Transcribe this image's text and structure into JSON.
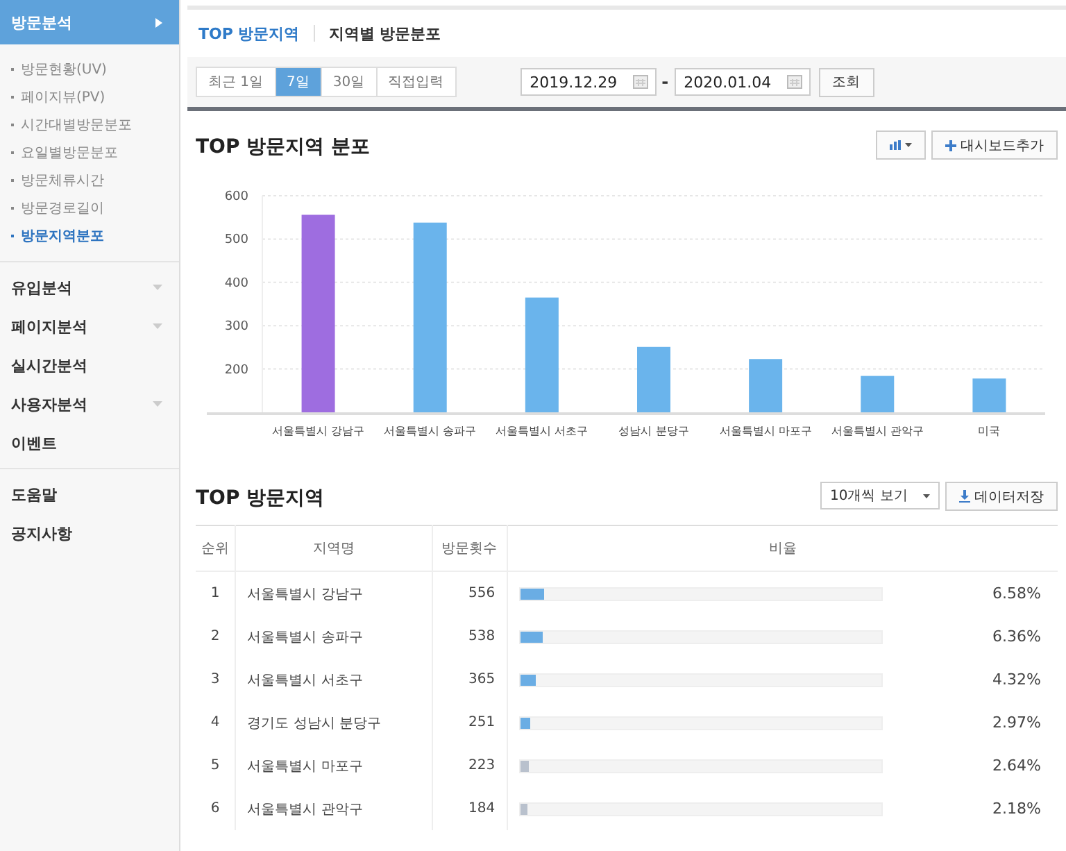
{
  "sidebar": {
    "items": [
      {
        "label": "방문분석",
        "expanded": true,
        "selected": true,
        "children": [
          {
            "label": "방문현황(UV)",
            "selected": false
          },
          {
            "label": "페이지뷰(PV)",
            "selected": false
          },
          {
            "label": "시간대별방문분포",
            "selected": false
          },
          {
            "label": "요일별방문분포",
            "selected": false
          },
          {
            "label": "방문체류시간",
            "selected": false
          },
          {
            "label": "방문경로길이",
            "selected": false
          },
          {
            "label": "방문지역분포",
            "selected": true
          }
        ]
      },
      {
        "label": "유입분석",
        "expanded": false,
        "selected": false
      },
      {
        "label": "페이지분석",
        "expanded": false,
        "selected": false
      },
      {
        "label": "실시간분석",
        "selected": false
      },
      {
        "label": "사용자분석",
        "expanded": false,
        "selected": false
      },
      {
        "label": "이벤트",
        "selected": false
      }
    ],
    "footer_items": [
      {
        "label": "도움말"
      },
      {
        "label": "공지사항"
      }
    ]
  },
  "tabs": [
    {
      "label": "TOP 방문지역",
      "selected": true
    },
    {
      "label": "지역별 방문분포",
      "selected": false
    }
  ],
  "period_buttons": [
    {
      "label": "최근 1일",
      "selected": false
    },
    {
      "label": "7일",
      "selected": true
    },
    {
      "label": "30일",
      "selected": false
    },
    {
      "label": "직접입력",
      "selected": false
    }
  ],
  "date_from": "2019.12.29",
  "date_separator": "-",
  "date_to": "2020.01.04",
  "search_button": "조회",
  "chart_section": {
    "title": "TOP 방문지역 분포",
    "add_button": "대시보드추가",
    "chart_data": {
      "type": "bar",
      "categories": [
        "서울특별시 강남구",
        "서울특별시 송파구",
        "서울특별시 서초구",
        "성남시 분당구",
        "서울특별시 마포구",
        "서울특별시 관악구",
        "미국"
      ],
      "series": [
        {
          "color": "#9e6de0",
          "values": [
            556,
            null,
            null,
            null,
            null,
            null,
            null
          ]
        },
        {
          "color": "#6ab4ec",
          "values": [
            null,
            538,
            365,
            251,
            223,
            184,
            178
          ]
        }
      ],
      "grid": true,
      "ylim": [
        100,
        600
      ],
      "yticks": [
        200,
        300,
        400,
        500,
        600
      ]
    }
  },
  "table_section": {
    "title": "TOP 방문지역",
    "page_size": "10개씩 보기",
    "download_button": "데이터저장",
    "columns": [
      "순위",
      "지역명",
      "방문횟수",
      "비율"
    ],
    "rows": [
      {
        "rank": "1",
        "region": "서울특별시 강남구",
        "visits": "556",
        "level": 0.0658,
        "ratio": "6.58%",
        "color": "#6aade4"
      },
      {
        "rank": "2",
        "region": "서울특별시 송파구",
        "visits": "538",
        "level": 0.0636,
        "ratio": "6.36%",
        "color": "#6aade4"
      },
      {
        "rank": "3",
        "region": "서울특별시 서초구",
        "visits": "365",
        "level": 0.0432,
        "ratio": "4.32%",
        "color": "#6aade4"
      },
      {
        "rank": "4",
        "region": "경기도 성남시 분당구",
        "visits": "251",
        "level": 0.0297,
        "ratio": "2.97%",
        "color": "#6aade4"
      },
      {
        "rank": "5",
        "region": "서울특별시 마포구",
        "visits": "223",
        "level": 0.0264,
        "ratio": "2.64%",
        "color": "#b9c1cd"
      },
      {
        "rank": "6",
        "region": "서울특별시 관악구",
        "visits": "184",
        "level": 0.0218,
        "ratio": "2.18%",
        "color": "#b9c1cd"
      }
    ]
  }
}
